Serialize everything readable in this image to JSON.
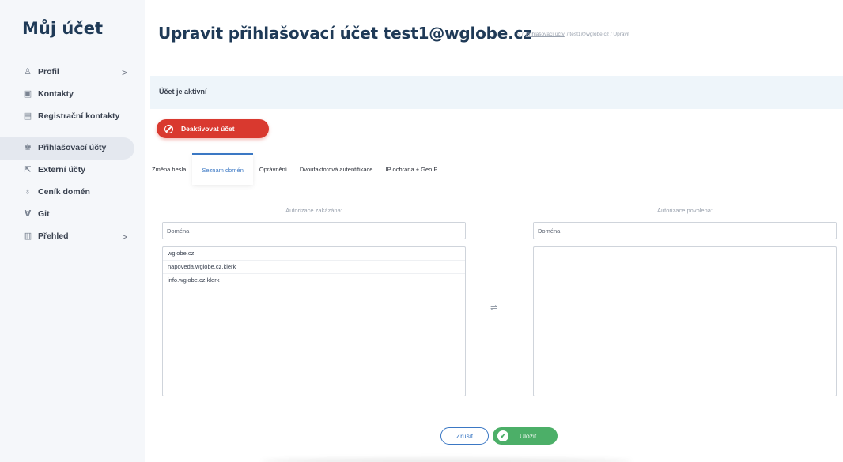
{
  "sidebar": {
    "title": "Můj účet",
    "items": [
      {
        "label": "Profil",
        "icon": "user-icon",
        "glyph": "♙",
        "chevron": ">",
        "active": false
      },
      {
        "label": "Kontakty",
        "icon": "contacts-icon",
        "glyph": "▣",
        "chevron": "",
        "active": false
      },
      {
        "label": "Registrační kontakty",
        "icon": "registration-icon",
        "glyph": "▤",
        "chevron": "",
        "active": false
      },
      {
        "label": "Přihlašovací účty",
        "icon": "users-icon",
        "glyph": "♚",
        "chevron": "",
        "active": true
      },
      {
        "label": "Externí účty",
        "icon": "external-link-icon",
        "glyph": "⇱",
        "chevron": "",
        "active": false
      },
      {
        "label": "Ceník domén",
        "icon": "price-tag-icon",
        "glyph": "♁",
        "chevron": "",
        "active": false
      },
      {
        "label": "Git",
        "icon": "git-icon",
        "glyph": "∀",
        "chevron": "",
        "active": false
      },
      {
        "label": "Přehled",
        "icon": "overview-icon",
        "glyph": "▥",
        "chevron": ">",
        "active": false
      }
    ]
  },
  "header": {
    "title": "Upravit přihlašovací účet test1@wglobe.cz",
    "breadcrumb": {
      "home_icon": "home-icon",
      "sep": "/",
      "link": "Přihlašovací účty",
      "rest": "/ test1@wglobe.cz / Upravit"
    }
  },
  "status": {
    "text": "Účet je aktivní"
  },
  "actions": {
    "deactivate_label": "Deaktivovat účet"
  },
  "tabs": [
    {
      "label": "Změna hesla",
      "active": false
    },
    {
      "label": "Seznam domén",
      "active": true
    },
    {
      "label": "Oprávnění",
      "active": false
    },
    {
      "label": "Dvoufaktorová autentifikace",
      "active": false
    },
    {
      "label": "IP ochrana + GeoIP",
      "active": false
    }
  ],
  "dual_list": {
    "left": {
      "header": "Autorizace zakázána:",
      "filter_placeholder": "Doména",
      "items": [
        "wglobe.cz",
        "napoveda.wglobe.cz.klerk",
        "info.wglobe.cz.klerk"
      ]
    },
    "right": {
      "header": "Autorizace povolena:",
      "filter_placeholder": "Doména",
      "items": []
    },
    "transfer_icon": "⇌"
  },
  "footer": {
    "cancel_label": "Zrušit",
    "save_label": "Uložit",
    "save_icon": "✔"
  },
  "colors": {
    "primary": "#3b78c4",
    "danger": "#d9392f",
    "success": "#4caf68",
    "title": "#1f3a57",
    "info_bg": "#eef5fa"
  }
}
